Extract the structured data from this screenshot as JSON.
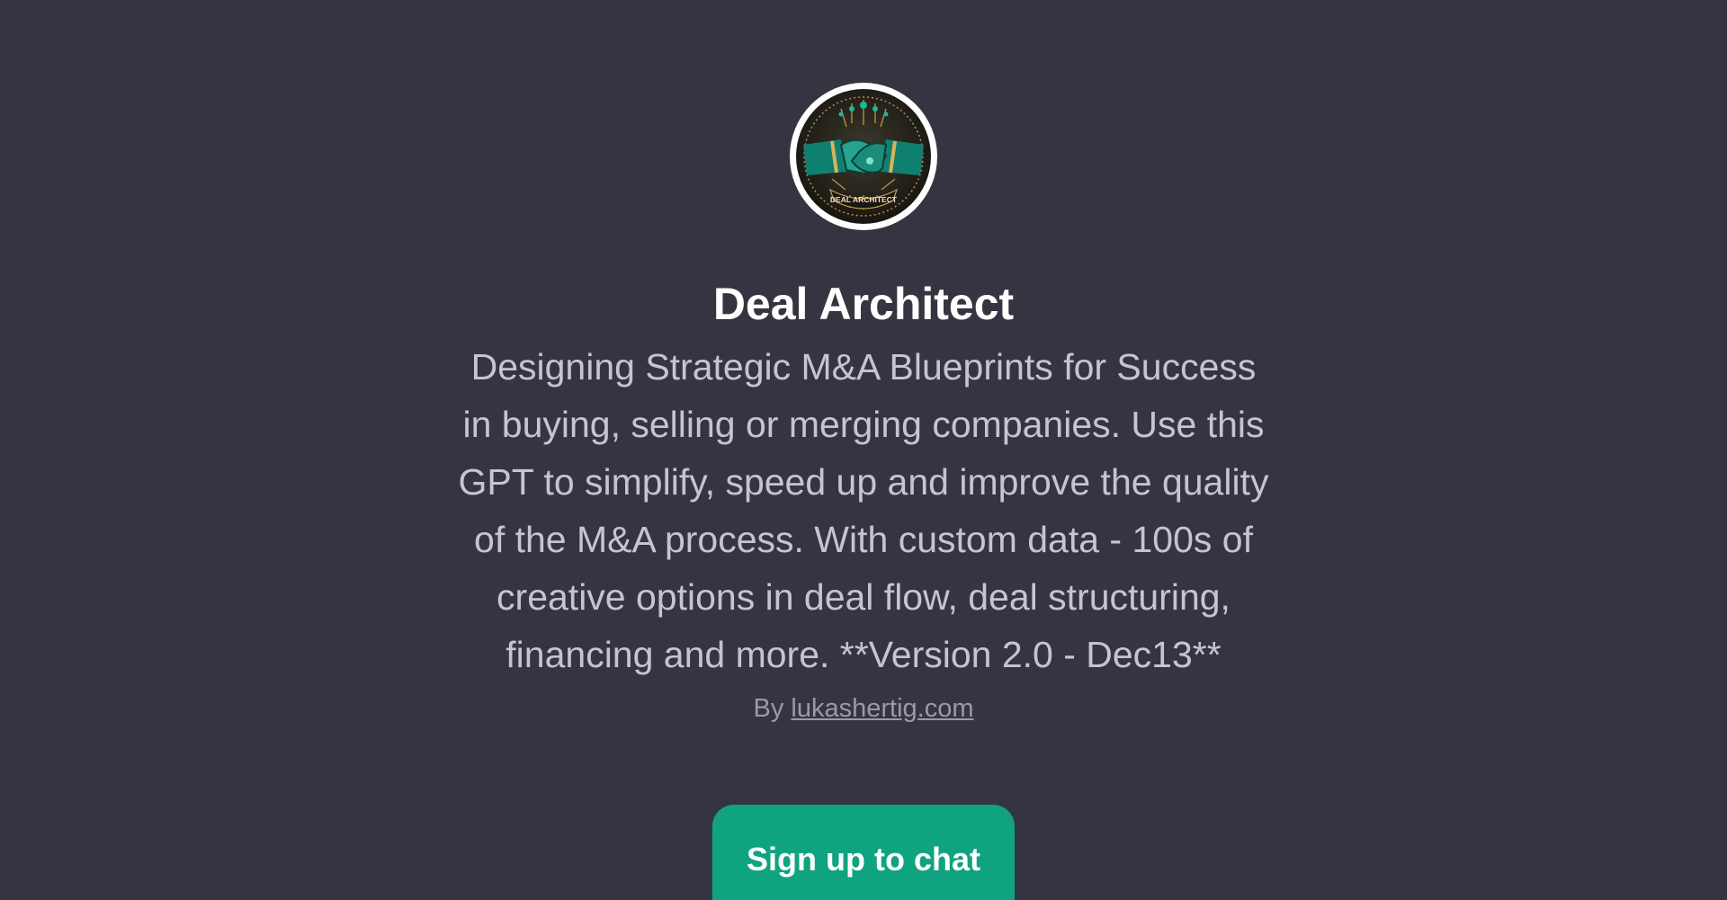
{
  "gpt": {
    "name": "Deal Architect",
    "avatar_icon": "handshake-icon",
    "logo_text": "DEAL ARCHITECT",
    "description_lines": [
      "Designing Strategic M&A Blueprints for Success",
      "in buying, selling or merging companies. Use this",
      "GPT to simplify, speed up and improve the quality",
      "of the M&A process. With custom data - 100s of",
      "creative options in deal flow, deal structuring,",
      "financing and more. **Version 2.0 - Dec13**"
    ],
    "byline_prefix": "By",
    "author_link": "lukashertig.com"
  },
  "cta": {
    "label": "Sign up to chat"
  },
  "colors": {
    "background": "#353541",
    "accent": "#10a37f",
    "title": "#ffffff",
    "description": "#c5c5d2"
  }
}
